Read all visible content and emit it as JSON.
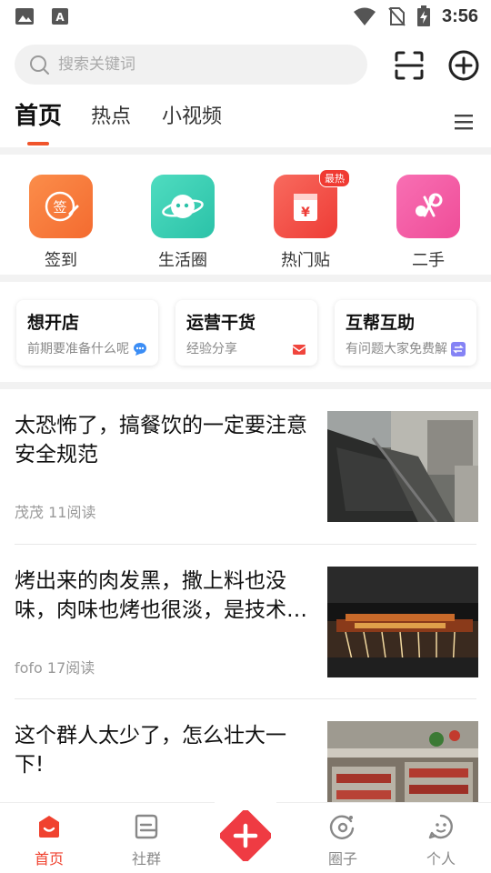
{
  "status_bar": {
    "time": "3:56"
  },
  "search": {
    "placeholder": "搜索关键词"
  },
  "tabs": [
    {
      "label": "首页",
      "active": true
    },
    {
      "label": "热点"
    },
    {
      "label": "小视频"
    }
  ],
  "quick_links": [
    {
      "label": "签到",
      "icon": "sign-in-icon",
      "color": "#f97a3e"
    },
    {
      "label": "生活圈",
      "icon": "planet-icon",
      "color": "#35cfb3"
    },
    {
      "label": "热门贴",
      "icon": "hot-post-icon",
      "color": "#f24b42",
      "badge": "最热"
    },
    {
      "label": "二手",
      "icon": "exchange-icon",
      "color": "#f45ea4"
    }
  ],
  "topic_cards": [
    {
      "title": "想开店",
      "subtitle": "前期要准备什么呢",
      "icon": "chat-bubble-icon",
      "icon_color": "#3b8df5"
    },
    {
      "title": "运营干货",
      "subtitle": "经验分享",
      "icon": "envelope-icon",
      "icon_color": "#f0453d"
    },
    {
      "title": "互帮互助",
      "subtitle": "有问题大家免费解",
      "icon": "swap-icon",
      "icon_color": "#6f6cf0"
    }
  ],
  "feed": [
    {
      "title": "太恐怖了，搞餐饮的一定要注意安全规范",
      "meta": "茂茂 11阅读",
      "image": "burnt-kitchen-image"
    },
    {
      "title": "烤出来的肉发黑，撒上料也没味，肉味也烤也很淡，是技术问题吗",
      "meta": "fofo 17阅读",
      "image": "bbq-skewers-image"
    },
    {
      "title": "这个群人太少了，怎么壮大一下!",
      "meta": "",
      "image": "raw-skewers-image"
    }
  ],
  "bottom_nav": [
    {
      "label": "首页",
      "active": true
    },
    {
      "label": "社群"
    },
    {
      "label": ""
    },
    {
      "label": "圈子"
    },
    {
      "label": "个人"
    }
  ],
  "colors": {
    "accent": "#f0422f",
    "indicator": "#f0542b"
  }
}
